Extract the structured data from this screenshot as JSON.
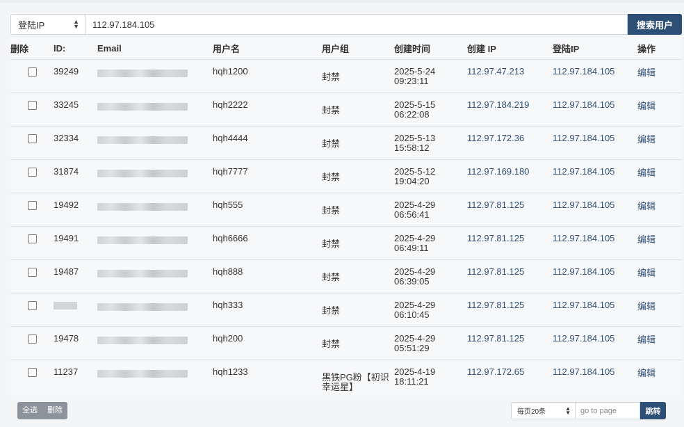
{
  "search": {
    "field_selected": "登陆IP",
    "value": "112.97.184.105",
    "button_label": "搜索用户"
  },
  "table": {
    "headers": {
      "delete": "删除",
      "id": "ID:",
      "email": "Email",
      "username": "用户名",
      "group": "用户组",
      "created": "创建时间",
      "create_ip": "创建 IP",
      "login_ip": "登陆IP",
      "action": "操作"
    },
    "rows": [
      {
        "id": "39249",
        "username": "hqh1200",
        "group": "封禁",
        "created_date": "2025-5-24",
        "created_time": "09:23:11",
        "create_ip": "112.97.47.213",
        "login_ip": "112.97.184.105",
        "action": "编辑"
      },
      {
        "id": "33245",
        "username": "hqh2222",
        "group": "封禁",
        "created_date": "2025-5-15",
        "created_time": "06:22:08",
        "create_ip": "112.97.184.219",
        "login_ip": "112.97.184.105",
        "action": "编辑"
      },
      {
        "id": "32334",
        "username": "hqh4444",
        "group": "封禁",
        "created_date": "2025-5-13",
        "created_time": "15:58:12",
        "create_ip": "112.97.172.36",
        "login_ip": "112.97.184.105",
        "action": "编辑"
      },
      {
        "id": "31874",
        "username": "hqh7777",
        "group": "封禁",
        "created_date": "2025-5-12",
        "created_time": "19:04:20",
        "create_ip": "112.97.169.180",
        "login_ip": "112.97.184.105",
        "action": "编辑"
      },
      {
        "id": "19492",
        "username": "hqh555",
        "group": "封禁",
        "created_date": "2025-4-29",
        "created_time": "06:56:41",
        "create_ip": "112.97.81.125",
        "login_ip": "112.97.184.105",
        "action": "编辑"
      },
      {
        "id": "19491",
        "username": "hqh6666",
        "group": "封禁",
        "created_date": "2025-4-29",
        "created_time": "06:49:11",
        "create_ip": "112.97.81.125",
        "login_ip": "112.97.184.105",
        "action": "编辑"
      },
      {
        "id": "19487",
        "username": "hqh888",
        "group": "封禁",
        "created_date": "2025-4-29",
        "created_time": "06:39:05",
        "create_ip": "112.97.81.125",
        "login_ip": "112.97.184.105",
        "action": "编辑"
      },
      {
        "id": "",
        "username": "hqh333",
        "group": "封禁",
        "created_date": "2025-4-29",
        "created_time": "06:10:45",
        "create_ip": "112.97.81.125",
        "login_ip": "112.97.184.105",
        "action": "编辑"
      },
      {
        "id": "19478",
        "username": "hqh200",
        "group": "封禁",
        "created_date": "2025-4-29",
        "created_time": "05:51:29",
        "create_ip": "112.97.81.125",
        "login_ip": "112.97.184.105",
        "action": "编辑"
      },
      {
        "id": "11237",
        "username": "hqh1233",
        "group": "黑铁PG粉【初识幸运星】",
        "created_date": "2025-4-19",
        "created_time": "18:11:21",
        "create_ip": "112.97.172.65",
        "login_ip": "112.97.184.105",
        "action": "编辑"
      }
    ]
  },
  "bulk": {
    "select_all": "全选",
    "delete": "删除"
  },
  "pager": {
    "per_page": "每页20条",
    "goto_placeholder": "go to page",
    "jump_label": "跳转"
  },
  "colors": {
    "primary": "#2d4e75",
    "muted_button": "#8c939a"
  }
}
